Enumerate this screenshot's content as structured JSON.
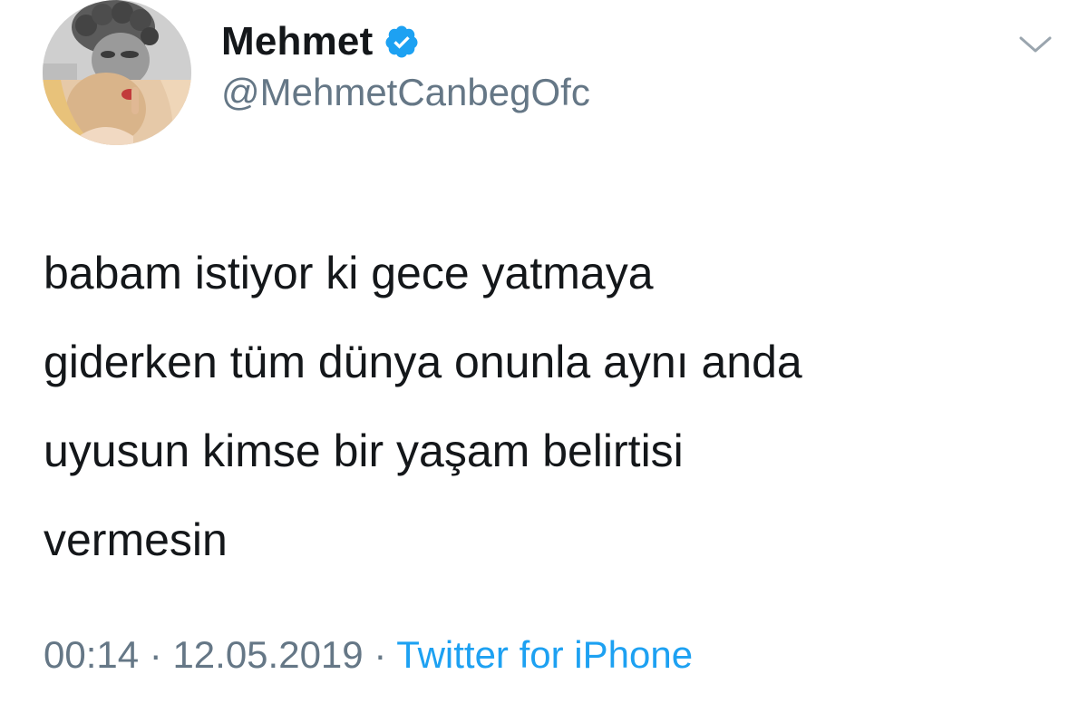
{
  "user": {
    "display_name": "Mehmet",
    "handle": "@MehmetCanbegOfc",
    "verified_icon": "verified-badge-icon",
    "avatar_icon": "avatar-image"
  },
  "menu": {
    "chevron_icon": "chevron-down-icon"
  },
  "tweet": {
    "text": "babam istiyor ki gece yatmaya\ngiderken tüm dünya onunla aynı anda\nuyusun kimse bir yaşam belirtisi\nvermesin"
  },
  "meta": {
    "time": "00:14",
    "separator": " · ",
    "date": "12.05.2019",
    "source": "Twitter for iPhone"
  },
  "colors": {
    "text": "#14171a",
    "secondary": "#657786",
    "accent": "#1da1f2",
    "background": "#ffffff"
  }
}
